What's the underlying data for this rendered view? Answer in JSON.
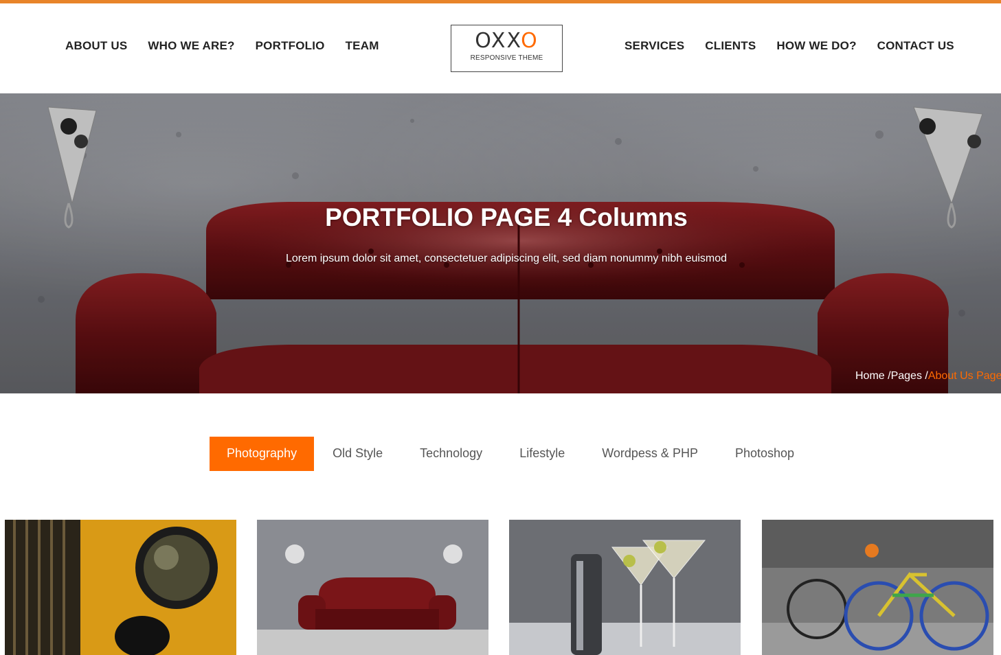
{
  "nav_left": [
    "ABOUT US",
    "WHO WE ARE?",
    "PORTFOLIO",
    "TEAM"
  ],
  "nav_right": [
    "SERVICES",
    "CLIENTS",
    "HOW WE DO?",
    "CONTACT US"
  ],
  "logo": {
    "mark_start": "OXX",
    "mark_end": "O",
    "subtitle": "RESPONSIVE THEME"
  },
  "hero": {
    "title": "PORTFOLIO PAGE 4 Columns",
    "subtitle": "Lorem ipsum dolor sit amet, consectetuer adipiscing elit, sed diam nonummy nibh euismod"
  },
  "breadcrumb": {
    "home": "Home /",
    "pages": "Pages /",
    "current": "About Us Page"
  },
  "filters": [
    "Photography",
    "Old Style",
    "Technology",
    "Lifestyle",
    "Wordpess & PHP",
    "Photoshop"
  ],
  "active_filter": "Photography",
  "colors": {
    "accent": "#ff6a00",
    "top_bar": "#e8842a",
    "nav_text": "#222222"
  }
}
